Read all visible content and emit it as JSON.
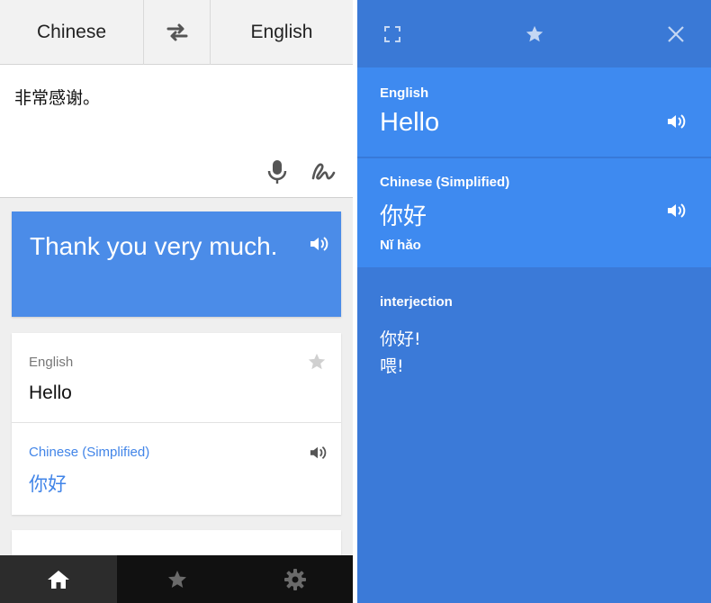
{
  "header": {
    "source_language": "Chinese",
    "target_language": "English",
    "swap_icon": "swap-arrows-icon"
  },
  "input": {
    "text": "非常感谢。",
    "mic_icon": "microphone-icon",
    "handwriting_icon": "handwriting-icon"
  },
  "translation": {
    "text": "Thank you very much.",
    "speaker_icon": "speaker-icon"
  },
  "dictionary_card": {
    "source_language_label": "English",
    "source_word": "Hello",
    "star_icon": "star-icon",
    "target_language_label": "Chinese (Simplified)",
    "target_word": "你好",
    "speaker_icon": "speaker-icon"
  },
  "bottom_nav": {
    "items": [
      "home-icon",
      "star-icon",
      "gear-icon"
    ],
    "active": "home"
  },
  "detail_panel": {
    "toolbar_icons": [
      "expand-icon",
      "star-icon",
      "close-icon"
    ],
    "source_language_label": "English",
    "source_word": "Hello",
    "target_language_label": "Chinese (Simplified)",
    "target_word": "你好",
    "romanization": "Nǐ hǎo",
    "part_of_speech": "interjection",
    "definitions": [
      "你好!",
      "喂!"
    ]
  },
  "colors": {
    "result_card": "#4b8ce8",
    "accent_blue": "#4285e8",
    "panel_blue": "#3b7ad8",
    "section_blue": "#3e8af0",
    "nav_dark": "#111111"
  }
}
